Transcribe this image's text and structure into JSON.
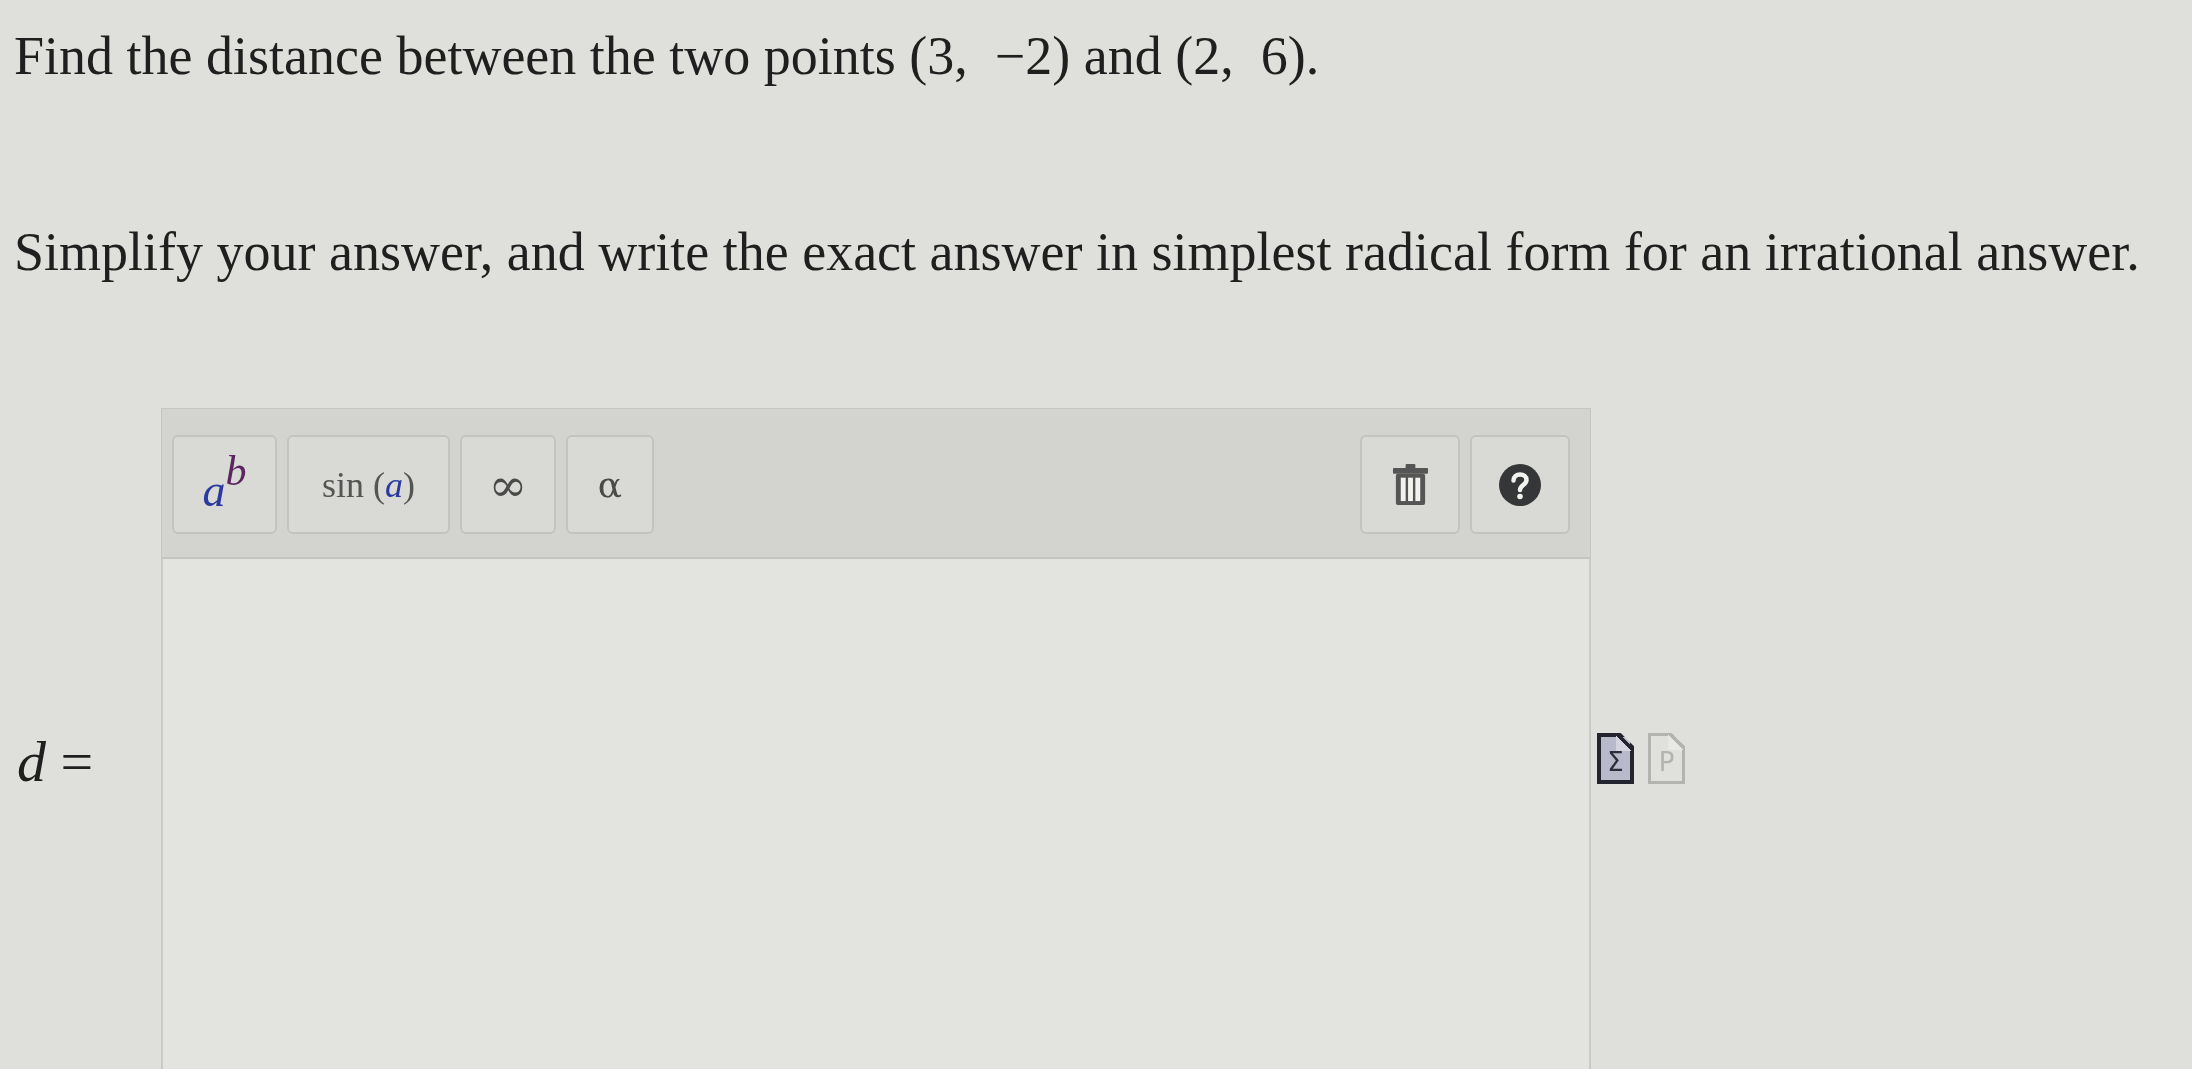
{
  "question": {
    "prompt": "Find the distance between the two points (3,  −2) and (2,  6).",
    "instruction": "Simplify your answer, and write the exact answer in simplest radical form for an irrational answer."
  },
  "answer": {
    "label": "*d* =",
    "toolbar": {
      "buttons": [
        {
          "kind": "power",
          "base": "a",
          "exponent": "b"
        },
        {
          "kind": "function",
          "label": "sin (*a*)"
        },
        {
          "kind": "symbol",
          "label": "∞"
        },
        {
          "kind": "symbol",
          "label": "α"
        }
      ],
      "tools": [
        {
          "kind": "trash"
        },
        {
          "kind": "help"
        }
      ]
    },
    "formats": [
      {
        "symbol": "Σ",
        "selected": true
      },
      {
        "symbol": "P",
        "selected": false
      }
    ]
  }
}
